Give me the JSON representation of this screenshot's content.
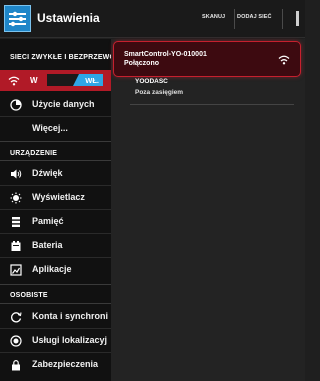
{
  "header": {
    "title": "Ustawienia",
    "actions": [
      "SKANUJ",
      "DODAJ SIEĆ"
    ]
  },
  "sidebar": {
    "sections": [
      "SIECI ZWYKŁE I BEZPRZEWODOWE",
      "URZĄDZENIE",
      "OSOBISTE"
    ],
    "wifi": {
      "label": "W",
      "toggle": "WŁ."
    },
    "items": [
      {
        "label": "Użycie danych",
        "icon": "data-usage-icon"
      },
      {
        "label": "Więcej...",
        "icon": ""
      },
      {
        "label": "Dźwięk",
        "icon": "speaker-icon"
      },
      {
        "label": "Wyświetlacz",
        "icon": "brightness-icon"
      },
      {
        "label": "Pamięć",
        "icon": "storage-icon"
      },
      {
        "label": "Bateria",
        "icon": "battery-icon"
      },
      {
        "label": "Aplikacje",
        "icon": "apps-icon"
      },
      {
        "label": "Konta i synchroni",
        "icon": "sync-icon"
      },
      {
        "label": "Usługi lokalizacyj",
        "icon": "location-icon"
      },
      {
        "label": "Zabezpieczenia",
        "icon": "lock-icon"
      }
    ]
  },
  "networks": [
    {
      "name": "SmartControl-YO-010001",
      "status": "Połączono"
    },
    {
      "name": "YOODASC",
      "status": "Poza zasięgiem"
    }
  ],
  "colors": {
    "accent": "#b11a27",
    "toggle_on": "#2ea6e6",
    "icon_blue": "#1f86c8"
  }
}
